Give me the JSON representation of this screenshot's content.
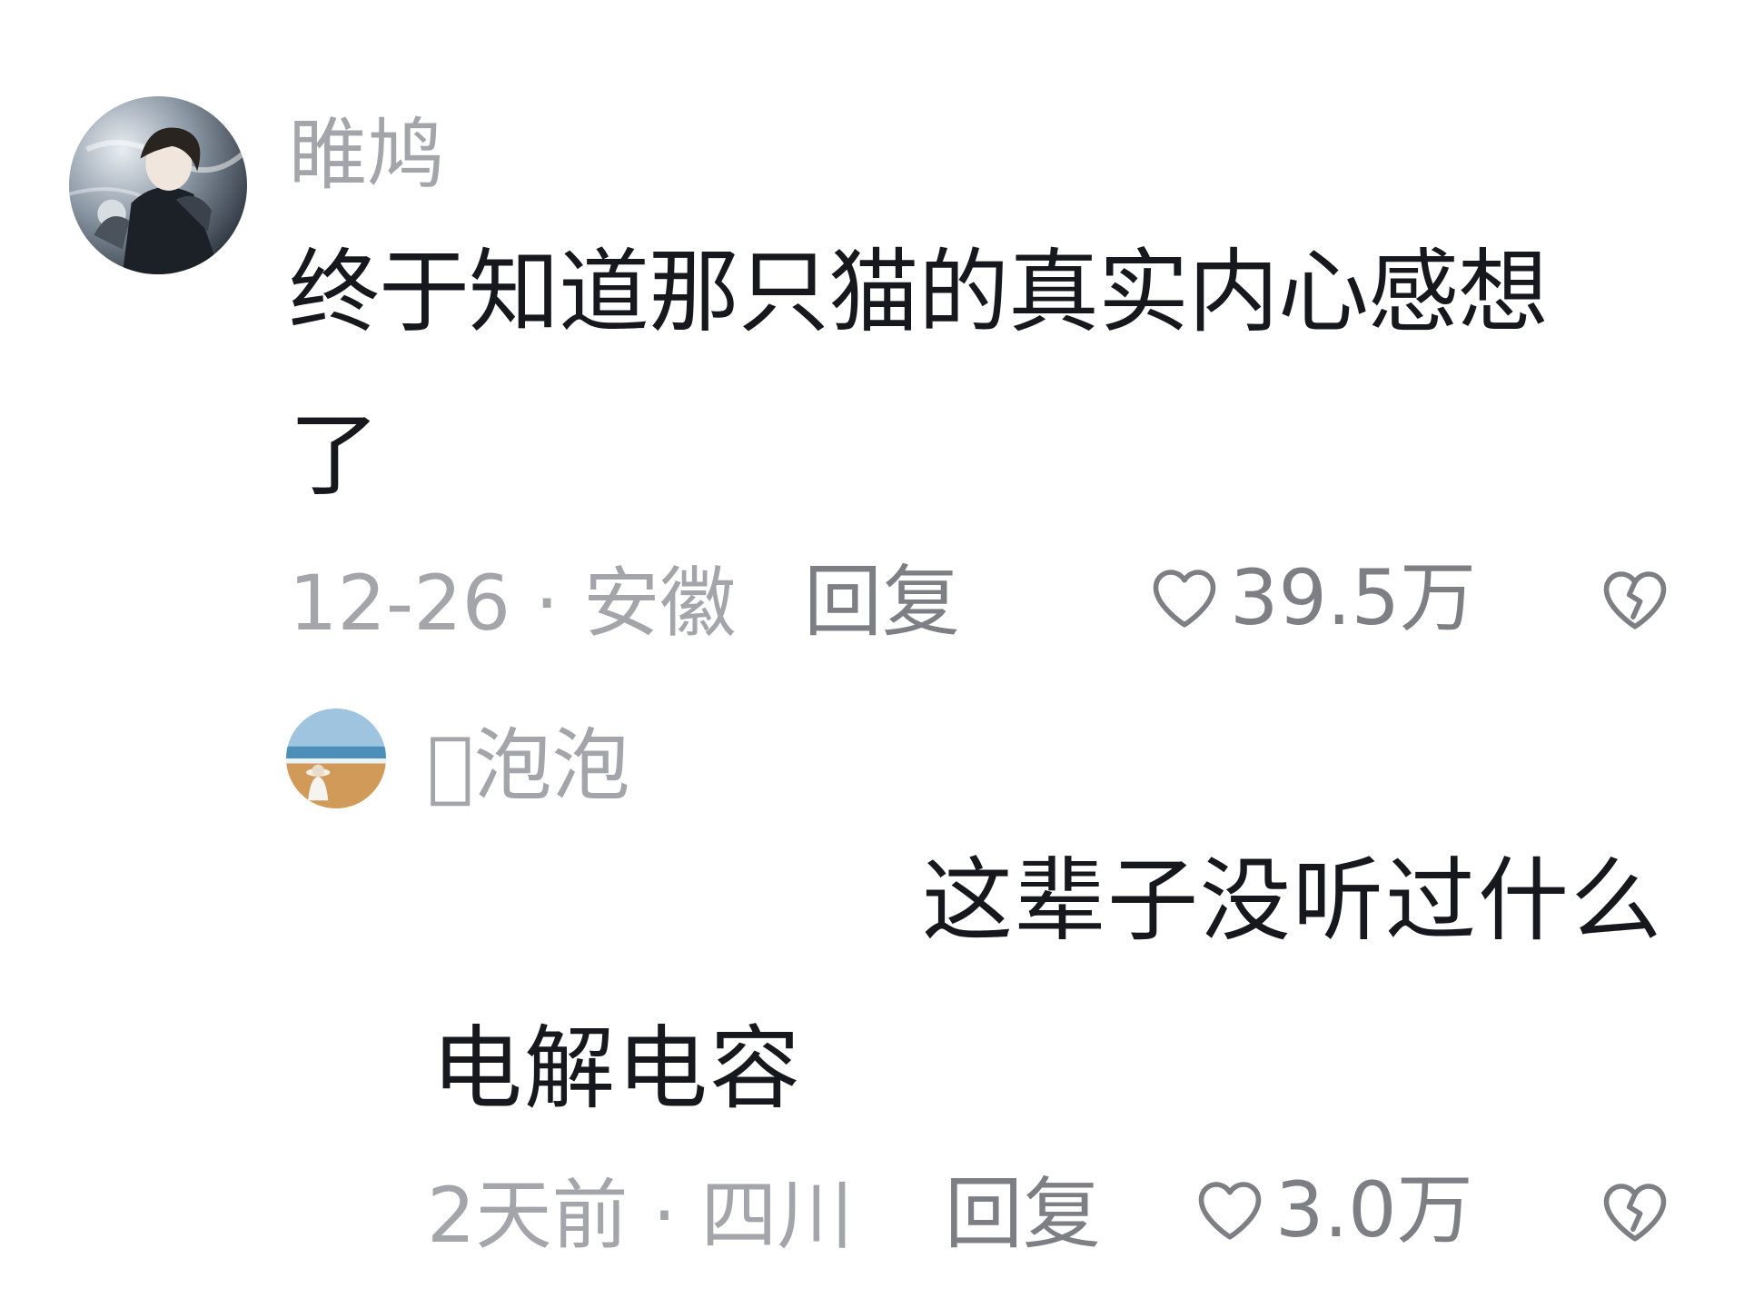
{
  "comment": {
    "username": "睢鸠",
    "text_line1": "终于知道那只猫的真实内心感想",
    "text_line2": "了",
    "meta": "12-26 · 安徽",
    "reply_label": "回复",
    "likes": "39.5万",
    "avatar_icon": "user-avatar-anime-boy",
    "like_icon": "heart-outline",
    "dislike_icon": "broken-heart"
  },
  "reply": {
    "username": "\u0000泡泡",
    "text_line1": "这辈子没听过什么",
    "text_line2": "电解电容",
    "meta": "2天前 · 四川",
    "reply_label": "回复",
    "likes": "3.0万",
    "avatar_icon": "user-avatar-beach",
    "like_icon": "heart-outline",
    "dislike_icon": "broken-heart"
  },
  "colors": {
    "text_primary": "#16181d",
    "text_secondary": "#a3a5aa",
    "action_gray": "#7d7f84",
    "background": "#ffffff"
  }
}
